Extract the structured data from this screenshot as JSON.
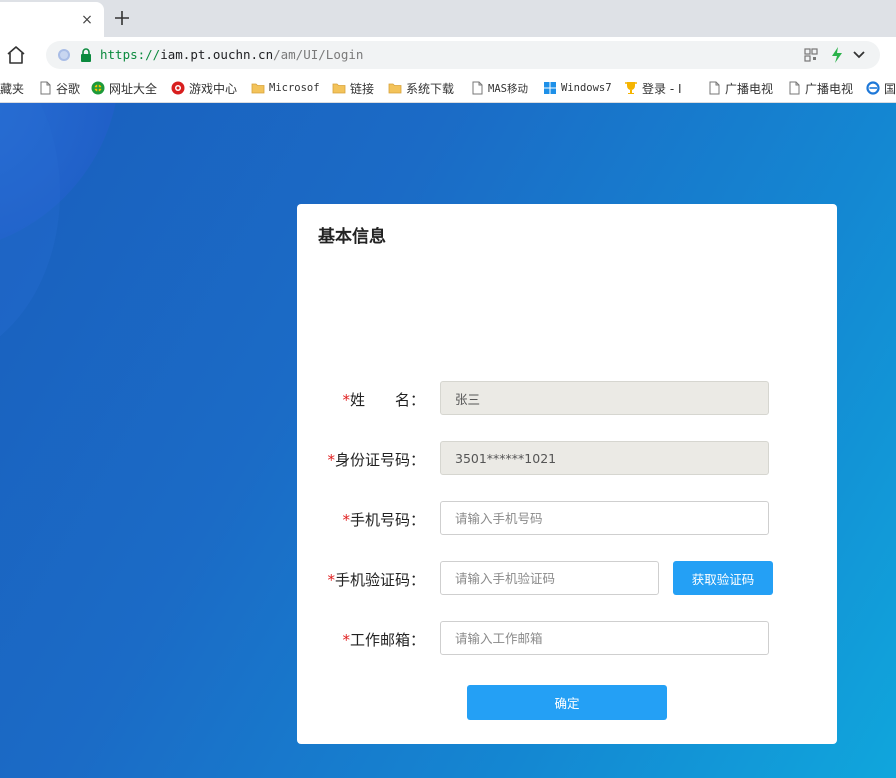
{
  "browser": {
    "tab_close_glyph": "×",
    "url": {
      "protocol": "https://",
      "host": "iam.pt.ouchn.cn",
      "path": "/am/UI/Login"
    },
    "bookmarks": [
      {
        "label": "藏夹",
        "icon": "none"
      },
      {
        "label": "谷歌",
        "icon": "page-icon"
      },
      {
        "label": "网址大全",
        "icon": "web-directory-icon"
      },
      {
        "label": "游戏中心",
        "icon": "game-center-icon"
      },
      {
        "label": "Microsof",
        "icon": "folder-icon"
      },
      {
        "label": "链接",
        "icon": "folder-icon"
      },
      {
        "label": "系统下载",
        "icon": "folder-icon"
      },
      {
        "label": "MAS移动",
        "icon": "page-icon"
      },
      {
        "label": "Windows7",
        "icon": "windows-icon"
      },
      {
        "label": "登录 - I",
        "icon": "trophy-icon"
      },
      {
        "label": "广播电视",
        "icon": "page-icon"
      },
      {
        "label": "广播电视",
        "icon": "page-icon"
      },
      {
        "label": "国",
        "icon": "ie-icon"
      }
    ]
  },
  "form": {
    "title": "基本信息",
    "required_mark": "*",
    "fields": {
      "name": {
        "label": "姓　　名：",
        "value": "张三",
        "placeholder": ""
      },
      "id_number": {
        "label": "身份证号码：",
        "value": "3501******1021",
        "placeholder": ""
      },
      "phone": {
        "label": "手机号码：",
        "value": "",
        "placeholder": "请输入手机号码"
      },
      "sms_code": {
        "label": "手机验证码：",
        "value": "",
        "placeholder": "请输入手机验证码"
      },
      "email": {
        "label": "工作邮箱：",
        "value": "",
        "placeholder": "请输入工作邮箱"
      }
    },
    "get_code_button": "获取验证码",
    "submit_button": "确定"
  },
  "colors": {
    "accent": "#24a0f5",
    "required": "#e02020",
    "readonly_bg": "#ebeae5"
  }
}
